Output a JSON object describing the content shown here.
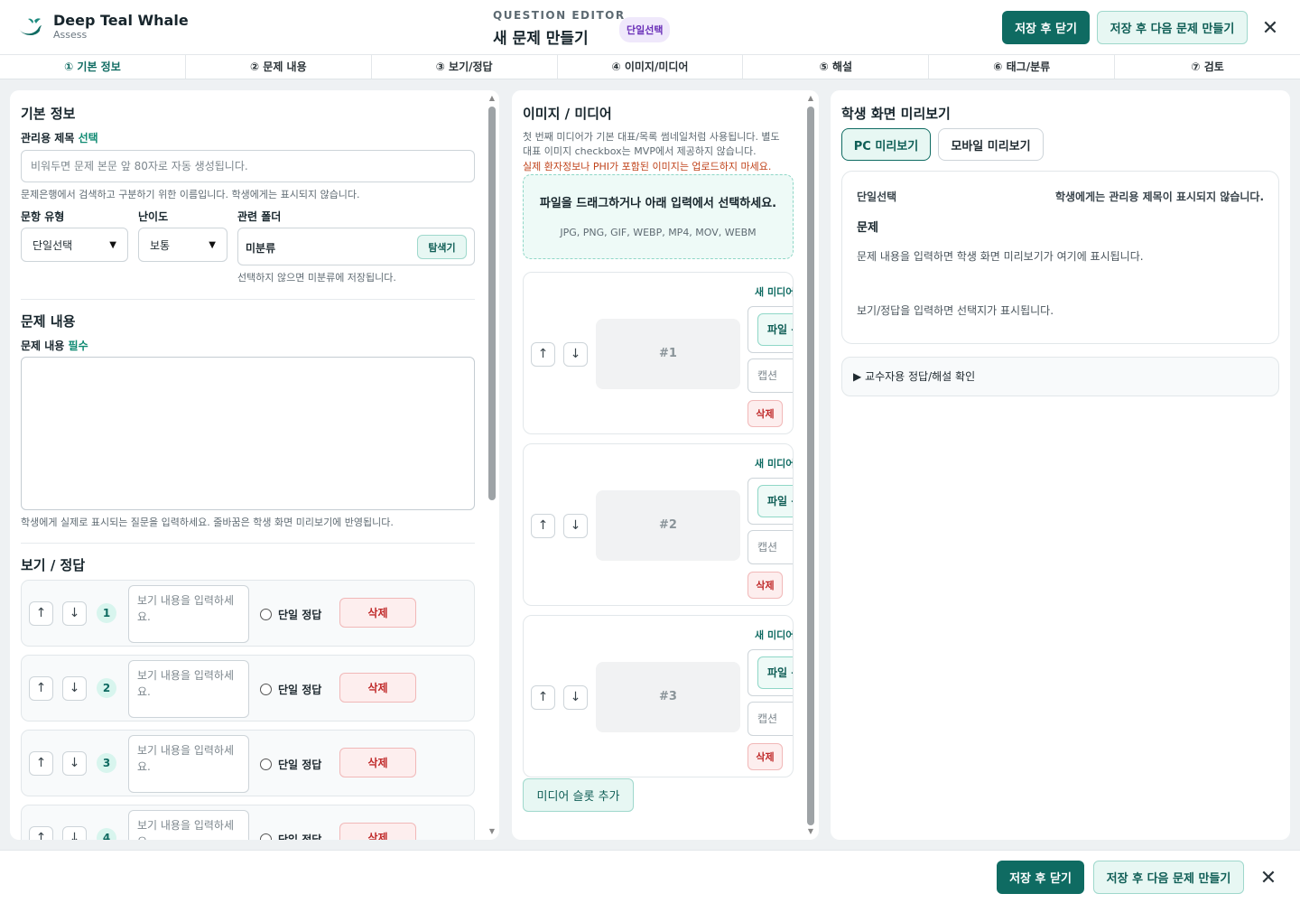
{
  "header": {
    "brand_name": "Deep Teal Whale",
    "brand_sub": "Assess",
    "eyebrow": "QUESTION EDITOR",
    "title": "새 문제 만들기",
    "type_badge": "단일선택",
    "save_close": "저장 후 닫기",
    "save_next": "저장 후 다음 문제 만들기",
    "close_glyph": "✕"
  },
  "tabs": [
    "① 기본 정보",
    "② 문제 내용",
    "③ 보기/정답",
    "④ 이미지/미디어",
    "⑤ 해설",
    "⑥ 태그/분류",
    "⑦ 검토"
  ],
  "basic": {
    "section_title": "기본 정보",
    "admin_title_label": "관리용 제목",
    "admin_title_tag": "선택",
    "admin_title_placeholder": "비워두면 문제 본문 앞 80자로 자동 생성됩니다.",
    "admin_title_hint": "문제은행에서 검색하고 구분하기 위한 이름입니다. 학생에게는 표시되지 않습니다.",
    "type_label": "문항 유형",
    "type_value": "단일선택",
    "difficulty_label": "난이도",
    "difficulty_value": "보통",
    "folder_label": "관련 폴더",
    "folder_value": "미분류",
    "folder_button": "탐색기",
    "folder_hint": "선택하지 않으면 미분류에 저장됩니다."
  },
  "content": {
    "section_title": "문제 내용",
    "label": "문제 내용",
    "tag": "필수",
    "hint": "학생에게 실제로 표시되는 질문을 입력하세요. 줄바꿈은 학생 화면 미리보기에 반영됩니다."
  },
  "options": {
    "section_title": "보기 / 정답",
    "up": "↑",
    "down": "↓",
    "items": [
      {
        "num": "1",
        "placeholder": "보기 내용을 입력하세요.",
        "radio_label": "단일 정답",
        "delete": "삭제"
      },
      {
        "num": "2",
        "placeholder": "보기 내용을 입력하세요.",
        "radio_label": "단일 정답",
        "delete": "삭제"
      },
      {
        "num": "3",
        "placeholder": "보기 내용을 입력하세요.",
        "radio_label": "단일 정답",
        "delete": "삭제"
      },
      {
        "num": "4",
        "placeholder": "보기 내용을 입력하세요.",
        "radio_label": "단일 정답",
        "delete": "삭제"
      }
    ]
  },
  "media": {
    "section_title": "이미지 / 미디어",
    "desc_line1": "첫 번째 미디어가 기본 대표/목록 썸네일처럼 사용됩니다. 별도",
    "desc_line2": "대표 이미지 checkbox는 MVP에서 제공하지 않습니다.",
    "warning": "실제 환자정보나 PHI가 포함된 이미지는 업로드하지 마세요.",
    "dropzone_main": "파일을 드래그하거나 아래 입력에서 선택하세요.",
    "dropzone_sub": "JPG, PNG, GIF, WEBP, MP4, MOV, WEBM",
    "up": "↑",
    "down": "↓",
    "slots": [
      {
        "badge": "새 미디어",
        "thumb": "#1",
        "file_button": "파일 선택",
        "caption": "캡션",
        "delete": "삭제"
      },
      {
        "badge": "새 미디어",
        "thumb": "#2",
        "file_button": "파일 선택",
        "caption": "캡션",
        "delete": "삭제"
      },
      {
        "badge": "새 미디어",
        "thumb": "#3",
        "file_button": "파일 선택",
        "caption": "캡션",
        "delete": "삭제"
      }
    ],
    "add_slot": "미디어 슬롯 추가"
  },
  "preview": {
    "section_title": "학생 화면 미리보기",
    "pc_tab": "PC 미리보기",
    "mobile_tab": "모바일 미리보기",
    "type": "단일선택",
    "note": "학생에게는 관리용 제목이 표시되지 않습니다.",
    "question_label": "문제",
    "body_placeholder": "문제 내용을 입력하면 학생 화면 미리보기가 여기에 표시됩니다.",
    "choices_placeholder": "보기/정답을 입력하면 선택지가 표시됩니다.",
    "details": "▶ 교수자용 정답/해설 확인"
  },
  "footer": {
    "save_close": "저장 후 닫기",
    "save_next": "저장 후 다음 문제 만들기",
    "close_glyph": "✕"
  },
  "colors": {
    "primary": "#0f6b62",
    "secondary_bg": "#e7f7f3",
    "danger": "#c02a2a",
    "badge_purple": "#6a2fb8"
  }
}
